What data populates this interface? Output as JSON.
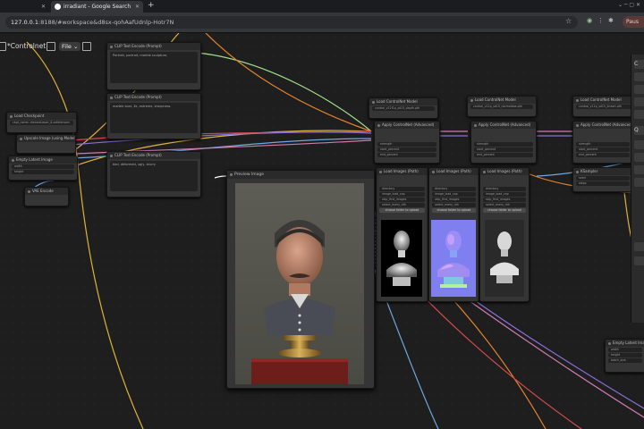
{
  "browser": {
    "tabs": [
      {
        "label": "",
        "active": false
      },
      {
        "label": "irradiant - Google Search",
        "active": true
      }
    ],
    "url_host": "127.0.0.1",
    "url_rest": ":8188/#workspace&d8sx-qohAafUdnlp-Hotr7N",
    "profile_label": "Paus"
  },
  "toolbar": {
    "workflow_title": "*Controlnet",
    "file_menu": "File"
  },
  "nodes": {
    "clip_text_1": {
      "title": "CLIP Text Encode (Prompt)",
      "text": "Portrait, portrait, marble sculpture,"
    },
    "clip_text_2": {
      "title": "CLIP Text Encode (Prompt)",
      "text": "marble bust, 4k, extreme, sharpness"
    },
    "clip_text_3": {
      "title": "CLIP Text Encode (Prompt)",
      "text": "bad, deformed, ugly, blurry"
    },
    "load_checkpoint": {
      "title": "Load Checkpoint",
      "widget": "ckpt_name: dreamshaper_8.safetensors"
    },
    "upscale_image": {
      "title": "Upscale Image (using Model)"
    },
    "empty_latent": {
      "title": "Empty Latent Image",
      "widgets": [
        "width",
        "height"
      ]
    },
    "vae_encode": {
      "title": "VAE Encode"
    },
    "cn_loader_1": {
      "title": "Load ControlNet Model",
      "widget": "control_v11f1p_sd15_depth.pth"
    },
    "cn_loader_2": {
      "title": "Load ControlNet Model",
      "widget": "control_v11p_sd15_normalbae.pth"
    },
    "cn_loader_3": {
      "title": "Load ControlNet Model",
      "widget": "control_v11p_sd15_lineart.pth"
    },
    "apply_cn_1": {
      "title": "Apply ControlNet (Advanced)",
      "widgets": [
        "strength",
        "start_percent",
        "end_percent"
      ]
    },
    "apply_cn_2": {
      "title": "Apply ControlNet (Advanced)",
      "widgets": [
        "strength",
        "start_percent",
        "end_percent"
      ]
    },
    "apply_cn_3": {
      "title": "Apply ControlNet (Advanced)",
      "widgets": [
        "strength",
        "start_percent",
        "end_percent"
      ]
    },
    "load_images_1": {
      "title": "Load Images (Path)",
      "widgets": [
        "directory",
        "image_load_cap",
        "skip_first_images",
        "select_every_nth"
      ],
      "button": "choose folder to upload"
    },
    "load_images_2": {
      "title": "Load Images (Path)",
      "widgets": [
        "directory",
        "image_load_cap",
        "skip_first_images",
        "select_every_nth"
      ],
      "button": "choose folder to upload"
    },
    "load_images_3": {
      "title": "Load Images (Path)",
      "widgets": [
        "directory",
        "image_load_cap",
        "skip_first_images",
        "select_every_nth"
      ],
      "button": "choose folder to upload"
    },
    "ksampler": {
      "title": "KSampler",
      "widgets": [
        "seed",
        "steps",
        "cfg",
        "sampler_name",
        "scheduler",
        "denoise"
      ]
    },
    "empty_latent_2": {
      "title": "Empty Latent Image",
      "widgets": [
        "width",
        "height",
        "batch_size"
      ]
    },
    "preview_image": {
      "title": "Preview Image"
    }
  },
  "right_panel": {
    "queue_label": "Q",
    "letter": "C"
  },
  "colors": {
    "wire_yellow": "#e0b23a",
    "wire_orange": "#e0822e",
    "wire_green": "#9fe08a",
    "wire_purple": "#8a6fd8",
    "wire_pink": "#d07bb0",
    "wire_blue": "#6fa8e0",
    "wire_red": "#d04a4a",
    "node_bg": "#353535"
  }
}
